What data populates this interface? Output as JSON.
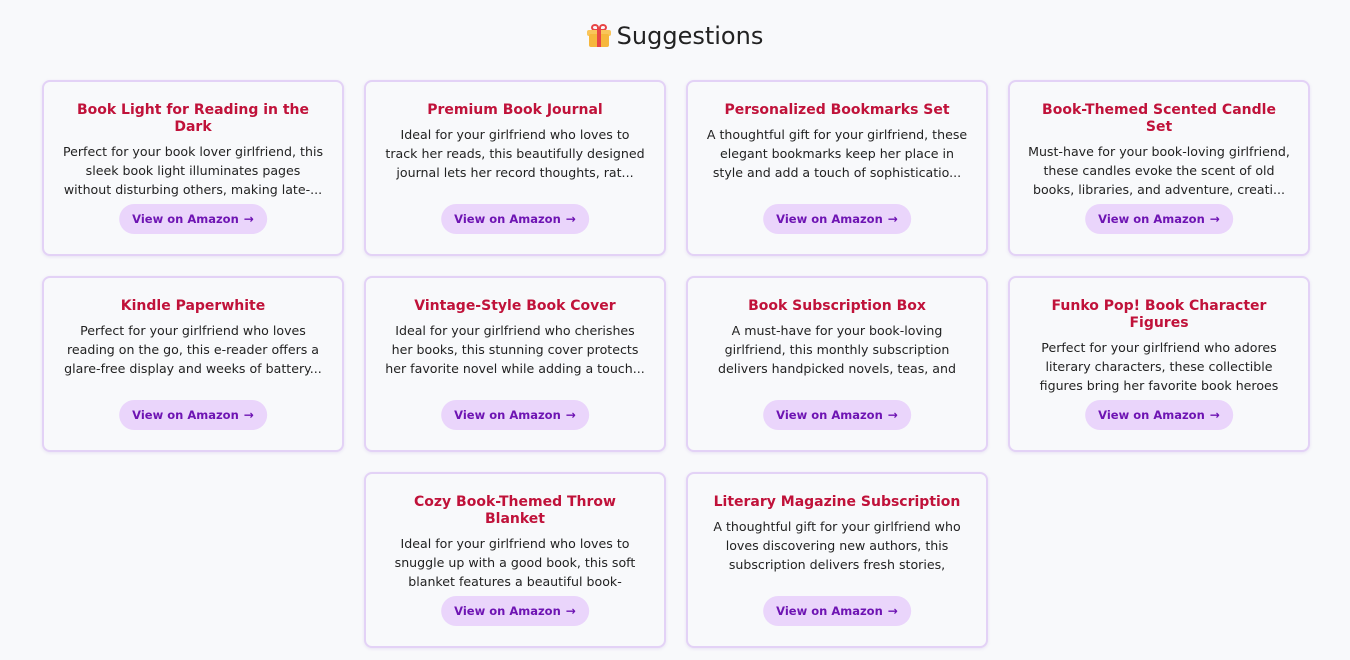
{
  "header": {
    "title": "Suggestions",
    "icon": "gift-icon"
  },
  "button_label": "View on Amazon",
  "cards": [
    {
      "title": "Book Light for Reading in the Dark",
      "description": "Perfect for your book lover girlfriend, this sleek book light illuminates pages without disturbing others, making late-..."
    },
    {
      "title": "Premium Book Journal",
      "description": "Ideal for your girlfriend who loves to track her reads, this beautifully designed journal lets her record thoughts, rat..."
    },
    {
      "title": "Personalized Bookmarks Set",
      "description": "A thoughtful gift for your girlfriend, these elegant bookmarks keep her place in style and add a touch of sophisticatio..."
    },
    {
      "title": "Book-Themed Scented Candle Set",
      "description": "Must-have for your book-loving girlfriend, these candles evoke the scent of old books, libraries, and adventure, creati..."
    },
    {
      "title": "Kindle Paperwhite",
      "description": "Perfect for your girlfriend who loves reading on the go, this e-reader offers a glare-free display and weeks of battery..."
    },
    {
      "title": "Vintage-Style Book Cover",
      "description": "Ideal for your girlfriend who cherishes her books, this stunning cover protects her favorite novel while adding a touch..."
    },
    {
      "title": "Book Subscription Box",
      "description": "A must-have for your book-loving girlfriend, this monthly subscription delivers handpicked novels, teas, and bookish tr..."
    },
    {
      "title": "Funko Pop! Book Character Figures",
      "description": "Perfect for your girlfriend who adores literary characters, these collectible figures bring her favorite book heroes to..."
    },
    {
      "title": "Cozy Book-Themed Throw Blanket",
      "description": "Ideal for your girlfriend who loves to snuggle up with a good book, this soft blanket features a beautiful book-inspire..."
    },
    {
      "title": "Literary Magazine Subscription",
      "description": "A thoughtful gift for your girlfriend who loves discovering new authors, this subscription delivers fresh stories, poem..."
    }
  ],
  "colors": {
    "title": "#c0123a",
    "button_bg": "#ead5fb",
    "button_text": "#6e14b3",
    "card_border": "#e3d2f6"
  }
}
